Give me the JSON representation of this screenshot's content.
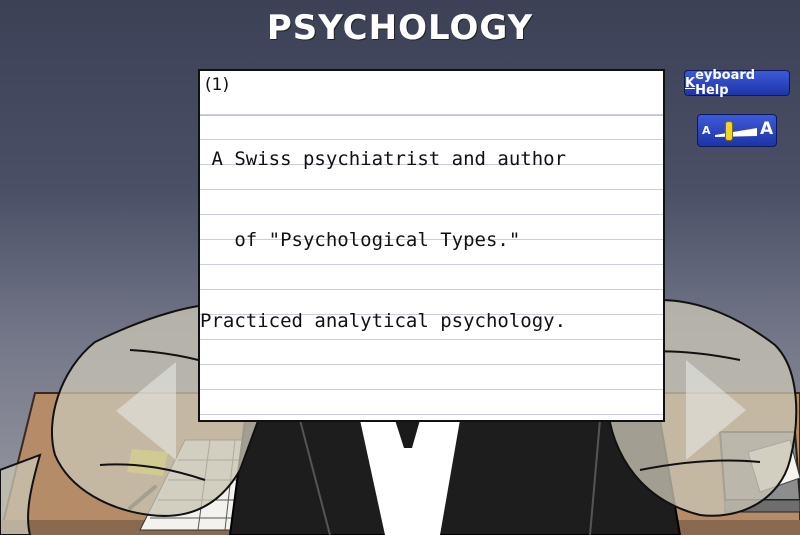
{
  "header": {
    "title": "PSYCHOLOGY"
  },
  "card": {
    "number": "(1)",
    "lines": [
      " A Swiss psychiatrist and author",
      "   of \"Psychological Types.\"",
      "Practiced analytical psychology."
    ]
  },
  "controls": {
    "keyboard_help_first": "K",
    "keyboard_help_rest": "eyboard Help",
    "font_small": "A",
    "font_large": "A"
  },
  "colors": {
    "button_blue": "#2a45c4",
    "desk": "#b48c68",
    "sticky_note": "#f1e021"
  }
}
